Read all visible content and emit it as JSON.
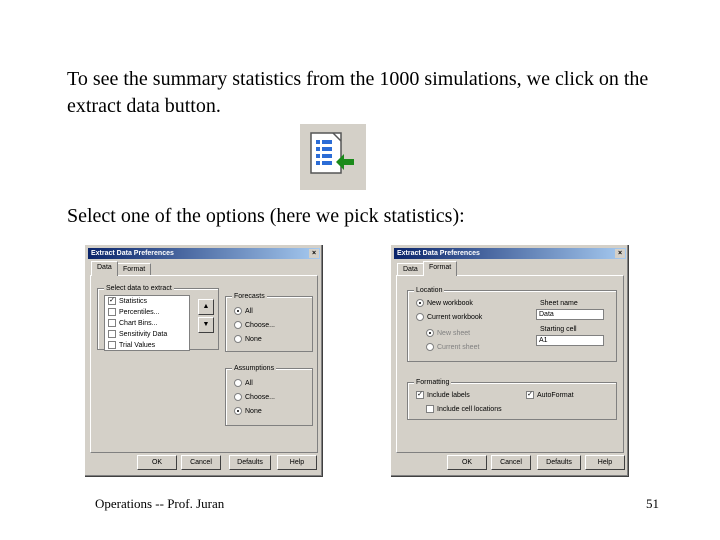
{
  "slide": {
    "paragraph1": "To see the summary statistics from the 1000 simulations, we click on the extract data button.",
    "paragraph2": "Select one of the options (here we pick statistics):",
    "footer": "Operations -- Prof. Juran",
    "page_number": "51"
  },
  "dialog1": {
    "title": "Extract Data Preferences",
    "tabs": [
      "Data",
      "Format"
    ],
    "select_label": "Select data to extract",
    "items": [
      "Statistics",
      "Percentiles...",
      "Chart Bins...",
      "Sensitivity Data",
      "Trial Values"
    ],
    "up_icon": "arrow-up",
    "down_icon": "arrow-down",
    "forecasts_label": "Forecasts",
    "forecast_options": [
      "All",
      "Choose...",
      "None"
    ],
    "assumptions_label": "Assumptions",
    "assumption_options": [
      "All",
      "Choose...",
      "None"
    ],
    "buttons": [
      "OK",
      "Cancel",
      "Defaults",
      "Help"
    ]
  },
  "dialog2": {
    "title": "Extract Data Preferences",
    "tabs": [
      "Data",
      "Format"
    ],
    "location_label": "Location",
    "location_options": [
      "New workbook",
      "Current workbook"
    ],
    "sub_options": [
      "New sheet",
      "Current sheet"
    ],
    "sheet_name_label": "Sheet name",
    "sheet_name_value": "Data",
    "starting_cell_label": "Starting cell",
    "starting_cell_value": "A1",
    "formatting_label": "Formatting",
    "include_labels": "Include labels",
    "autoformat": "AutoFormat",
    "include_cell_locations": "Include cell locations",
    "buttons": [
      "OK",
      "Cancel",
      "Defaults",
      "Help"
    ]
  },
  "colors": {
    "dialog_face": "#d4d0c8",
    "title_bar": "#0a246a",
    "icon_arrow": "#1a8a1a"
  }
}
